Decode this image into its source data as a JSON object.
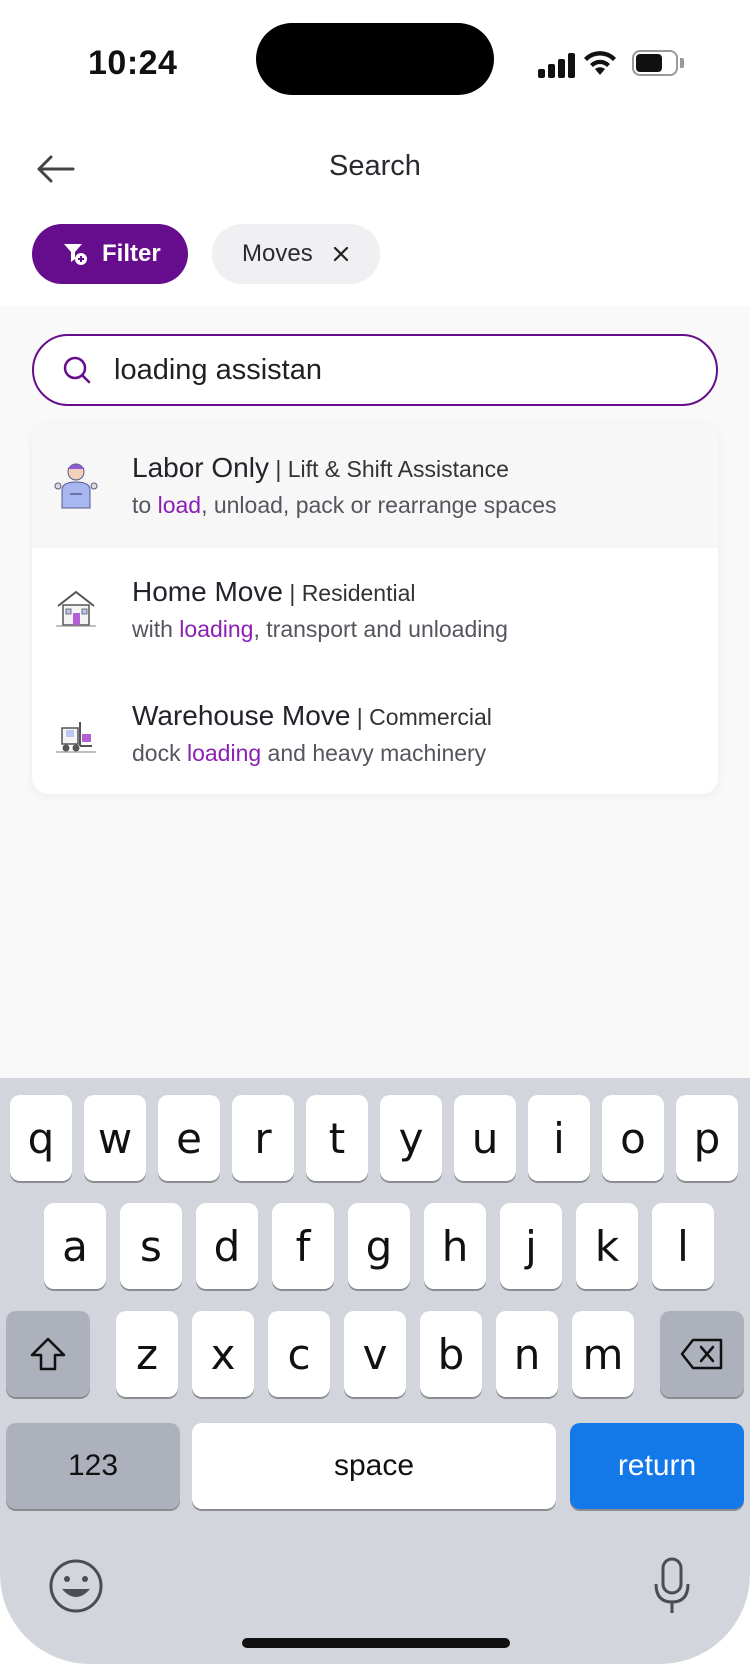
{
  "status_bar": {
    "time": "10:24"
  },
  "header": {
    "title": "Search"
  },
  "chips": {
    "filter_label": "Filter",
    "moves_label": "Moves"
  },
  "search": {
    "value": "loading assistan"
  },
  "results": [
    {
      "title": "Labor Only",
      "subtitle": " | Lift & Shift Assistance",
      "desc_pre": "to ",
      "desc_hl": "load",
      "desc_post": ", unload, pack or rearrange spaces"
    },
    {
      "title": "Home Move",
      "subtitle": " | Residential",
      "desc_pre": "with ",
      "desc_hl": "loading",
      "desc_post": ", transport and unloading"
    },
    {
      "title": "Warehouse Move",
      "subtitle": " | Commercial",
      "desc_pre": "dock ",
      "desc_hl": "loading",
      "desc_post": " and heavy machinery"
    }
  ],
  "keyboard": {
    "row1": [
      "q",
      "w",
      "e",
      "r",
      "t",
      "y",
      "u",
      "i",
      "o",
      "p"
    ],
    "row2": [
      "a",
      "s",
      "d",
      "f",
      "g",
      "h",
      "j",
      "k",
      "l"
    ],
    "row3": [
      "z",
      "x",
      "c",
      "v",
      "b",
      "n",
      "m"
    ],
    "num_label": "123",
    "space_label": "space",
    "return_label": "return"
  },
  "colors": {
    "brand": "#650d8c",
    "highlight": "#8b1fb3",
    "return_key": "#1479e8"
  }
}
